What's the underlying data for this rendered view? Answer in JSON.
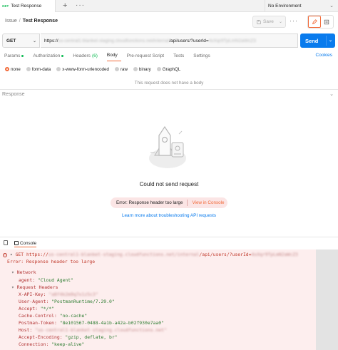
{
  "tab_bar": {
    "active_tab": {
      "method": "GET",
      "title": "Test Response"
    },
    "new_tab": "+",
    "more": "···",
    "environment": "No Environment"
  },
  "breadcrumb": {
    "parent": "Issue",
    "separator": "/",
    "current": "Test Response"
  },
  "toolbar": {
    "save_label": "Save",
    "more": "···"
  },
  "request": {
    "method": "GET",
    "url_prefix": "https://",
    "url_hidden": "us-central1-blanket-staging.cloudfunctions.net/internal",
    "url_path": "/api/users/?userId=",
    "url_hidden_2": "4xXqr9TpLmN2aWcZ3",
    "send_label": "Send"
  },
  "request_tabs": [
    {
      "label": "Params",
      "dot": true
    },
    {
      "label": "Authorization",
      "dot": true
    },
    {
      "label": "Headers",
      "count": "(6)"
    },
    {
      "label": "Body",
      "active": true
    },
    {
      "label": "Pre-request Script"
    },
    {
      "label": "Tests"
    },
    {
      "label": "Settings"
    }
  ],
  "cookies_label": "Cookies",
  "body_options": [
    {
      "label": "none",
      "selected": true
    },
    {
      "label": "form-data"
    },
    {
      "label": "x-www-form-urlencoded"
    },
    {
      "label": "raw"
    },
    {
      "label": "binary"
    },
    {
      "label": "GraphQL"
    }
  ],
  "no_body_text": "This request does not have a body",
  "response": {
    "label": "Response",
    "empty_title": "Could not send request",
    "error_text": "Error: Response header too large",
    "view_console": "View in Console",
    "learn_more": "Learn more about troubleshooting API requests"
  },
  "bottom_bar": {
    "console_label": "Console"
  },
  "console": {
    "request_method": "GET",
    "request_prefix": "https://",
    "request_hidden": "us-central1-blanket-staging.cloudfunctions.net/internal",
    "request_path": "/api/users/?userId=",
    "request_hidden_2": "4xXqr9TpLmN2aWcZ3",
    "error_line": "Error: Response header too large",
    "network_label": "Network",
    "agent_key": "agent:",
    "agent_value": "\"Cloud Agent\"",
    "request_headers_label": "Request Headers",
    "headers": [
      {
        "key": "X-API-Key:",
        "value": "\"a8f4k2m9q7x1z5c3\"",
        "hidden": true
      },
      {
        "key": "User-Agent:",
        "value": "\"PostmanRuntime/7.29.0\""
      },
      {
        "key": "Accept:",
        "value": "\"*/*\""
      },
      {
        "key": "Cache-Control:",
        "value": "\"no-cache\""
      },
      {
        "key": "Postman-Token:",
        "value": "\"8e101567-0488-4a1b-a42a-b02f930e7aa0\""
      },
      {
        "key": "Host:",
        "value": "\"us-central1-blanket-staging.cloudfunctions.net\"",
        "hidden": true
      },
      {
        "key": "Accept-Encoding:",
        "value": "\"gzip, deflate, br\""
      },
      {
        "key": "Connection:",
        "value": "\"keep-alive\""
      }
    ]
  },
  "colors": {
    "accent_orange": "#f26b3a",
    "send_blue": "#097bed",
    "get_green": "#0cbb52",
    "console_bg": "#fdeeee"
  }
}
